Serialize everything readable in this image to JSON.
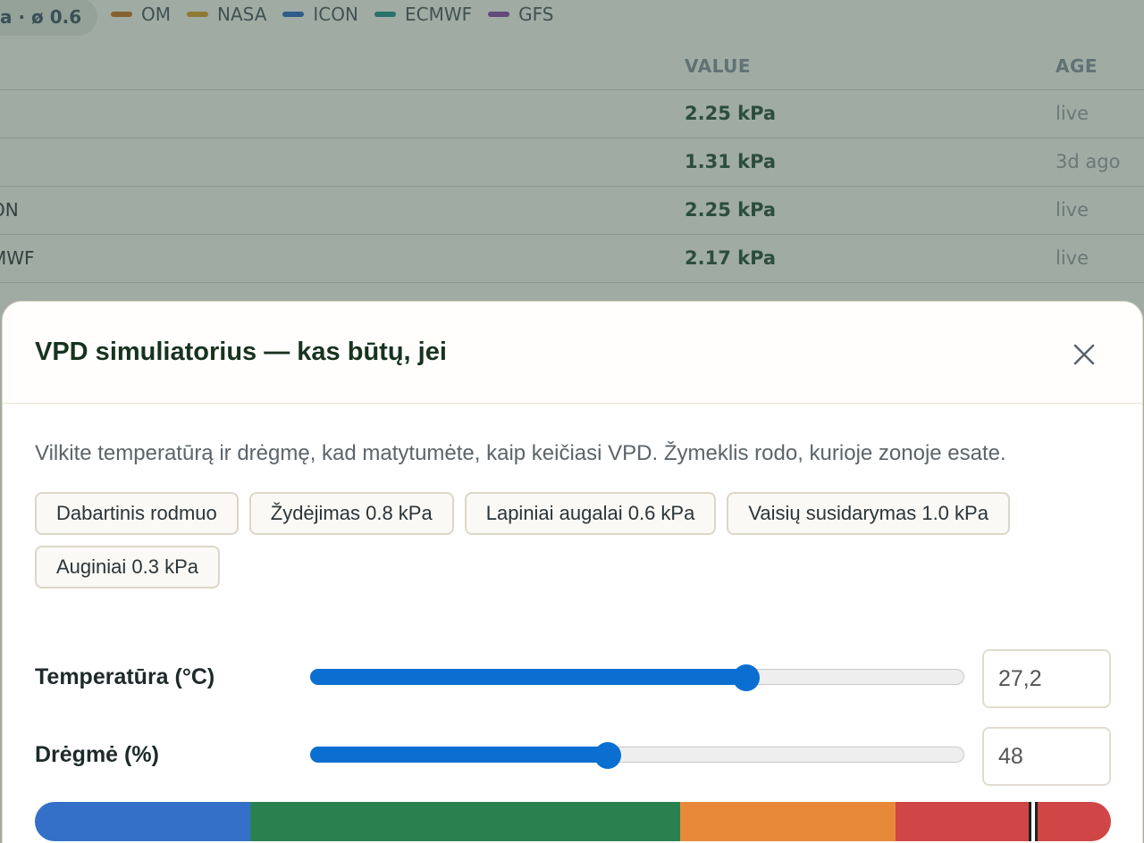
{
  "background": {
    "avg_pill": "a · ø 0.6",
    "legend": [
      {
        "label": "OM",
        "color": "#c26a1a"
      },
      {
        "label": "NASA",
        "color": "#d09a1c"
      },
      {
        "label": "ICON",
        "color": "#1b5fc0"
      },
      {
        "label": "ECMWF",
        "color": "#0d8a85"
      },
      {
        "label": "GFS",
        "color": "#7b3aa0"
      }
    ],
    "table": {
      "headers": {
        "value": "VALUE",
        "age": "AGE"
      },
      "rows": [
        {
          "name": "",
          "value": "2.25 kPa",
          "age": "live"
        },
        {
          "name": "",
          "value": "1.31 kPa",
          "age": "3d ago"
        },
        {
          "name": "ON",
          "value": "2.25 kPa",
          "age": "live"
        },
        {
          "name": "MWF",
          "value": "2.17 kPa",
          "age": "live"
        }
      ]
    }
  },
  "modal": {
    "title": "VPD simuliatorius — kas būtų, jei",
    "close_icon": "close-icon",
    "description": "Vilkite temperatūrą ir drėgmę, kad matytumėte, kaip keičiasi VPD. Žymeklis rodo, kurioje zonoje esate.",
    "presets": [
      "Dabartinis rodmuo",
      "Žydėjimas 0.8 kPa",
      "Lapiniai augalai 0.6 kPa",
      "Vaisių susidarymas 1.0 kPa",
      "Auginiai 0.3 kPa"
    ],
    "temperature": {
      "label": "Temperatūra (°C)",
      "value": "27,2",
      "slider_fraction": 0.666
    },
    "humidity": {
      "label": "Drėgmė (%)",
      "value": "48",
      "slider_fraction": 0.455
    },
    "zones": [
      {
        "color": "#3470c8",
        "fraction": 0.2
      },
      {
        "color": "#2b8050",
        "fraction": 0.4
      },
      {
        "color": "#e8893a",
        "fraction": 0.2
      },
      {
        "color": "#d04545",
        "fraction": 0.2
      }
    ],
    "marker_fraction": 0.928
  }
}
